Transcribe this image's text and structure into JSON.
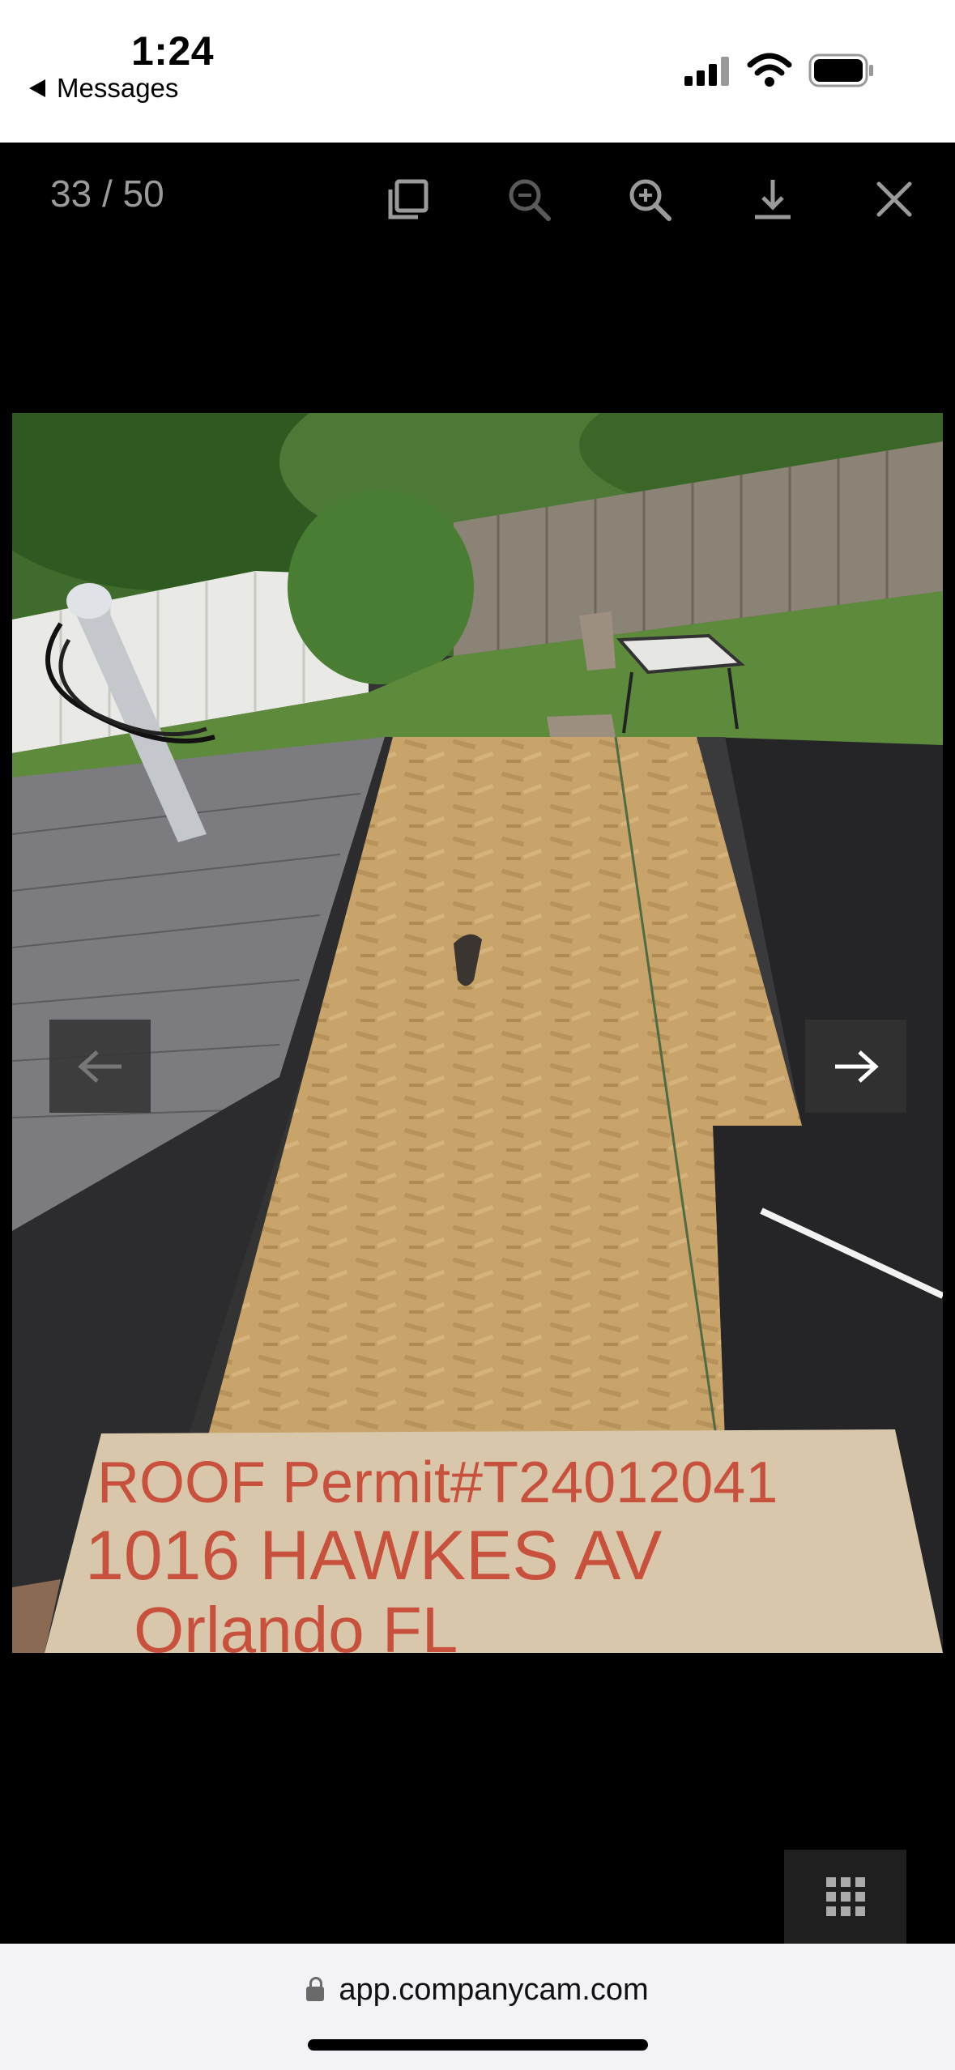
{
  "status": {
    "time": "1:24",
    "back_label": "Messages",
    "icons": [
      "signal-icon",
      "wifi-icon",
      "battery-icon"
    ]
  },
  "viewer": {
    "counter": "33 / 50",
    "toolbar": [
      {
        "name": "fullscreen-icon"
      },
      {
        "name": "zoom-out-icon"
      },
      {
        "name": "zoom-in-icon"
      },
      {
        "name": "download-icon"
      },
      {
        "name": "close-icon"
      }
    ],
    "prev_icon": "arrow-left-icon",
    "next_icon": "arrow-right-icon",
    "grid_icon": "grid-icon"
  },
  "photo": {
    "description": "Roof with exposed OSB sheathing, fence and yard in background",
    "sign_lines": [
      "ROOF Permit#T24012041",
      "1016 HAWKES AV",
      "Orlando FL"
    ]
  },
  "browser": {
    "url": "app.companycam.com"
  },
  "colors": {
    "status_bg": "#ffffff",
    "viewer_bg": "#000000",
    "toolbar_icon": "#9a9a9a",
    "address_bg": "#f2f2f7"
  }
}
